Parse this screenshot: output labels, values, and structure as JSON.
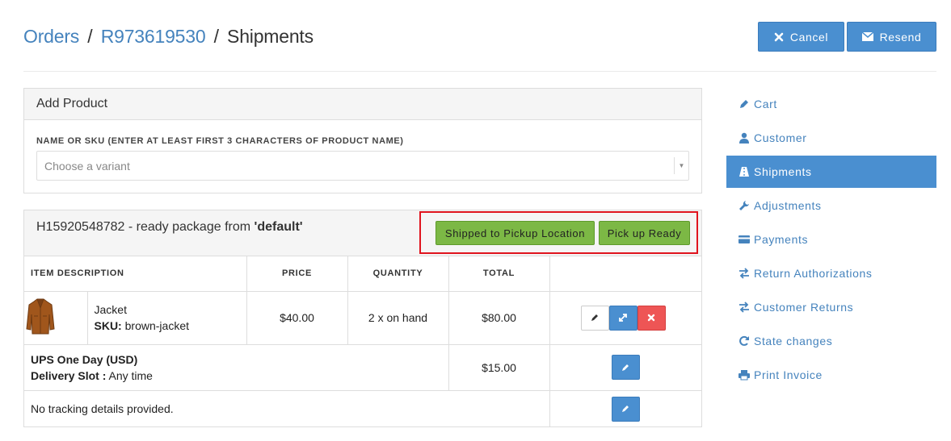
{
  "breadcrumb": {
    "orders": "Orders",
    "sep1": "/",
    "order_number": "R973619530",
    "sep2": "/",
    "current": "Shipments"
  },
  "header_buttons": {
    "cancel": "Cancel",
    "resend": "Resend"
  },
  "add_product": {
    "title": "Add Product",
    "field_label": "NAME OR SKU (ENTER AT LEAST FIRST 3 CHARACTERS OF PRODUCT NAME)",
    "placeholder": "Choose a variant"
  },
  "shipment": {
    "number": "H15920548782",
    "status_text": " - ready package from ",
    "location": "'default'",
    "btn_shipped_pickup": "Shipped to Pickup Location",
    "btn_pickup_ready": "Pick up Ready",
    "columns": {
      "item": "ITEM DESCRIPTION",
      "price": "PRICE",
      "quantity": "QUANTITY",
      "total": "TOTAL"
    },
    "item": {
      "name": "Jacket",
      "sku_label": "SKU:",
      "sku": " brown-jacket",
      "price": "$40.00",
      "quantity": "2 x on hand",
      "total": "$80.00"
    },
    "shipping": {
      "method": "UPS One Day (USD)",
      "slot_label": "Delivery Slot :",
      "slot_value": " Any time",
      "cost": "$15.00"
    },
    "tracking": "No tracking details provided."
  },
  "sidebar": {
    "items": [
      {
        "label": "Cart",
        "icon": "pencil-icon"
      },
      {
        "label": "Customer",
        "icon": "user-icon"
      },
      {
        "label": "Shipments",
        "icon": "road-icon",
        "active": true
      },
      {
        "label": "Adjustments",
        "icon": "wrench-icon"
      },
      {
        "label": "Payments",
        "icon": "credit-card-icon"
      },
      {
        "label": "Return Authorizations",
        "icon": "transfer-icon"
      },
      {
        "label": "Customer Returns",
        "icon": "transfer-icon"
      },
      {
        "label": "State changes",
        "icon": "refresh-icon"
      },
      {
        "label": "Print Invoice",
        "icon": "print-icon"
      }
    ]
  },
  "colors": {
    "link": "#4583bd",
    "primary": "#4a8fd0",
    "success": "#7cb845",
    "danger": "#ee5555",
    "highlight": "#e0141e"
  }
}
